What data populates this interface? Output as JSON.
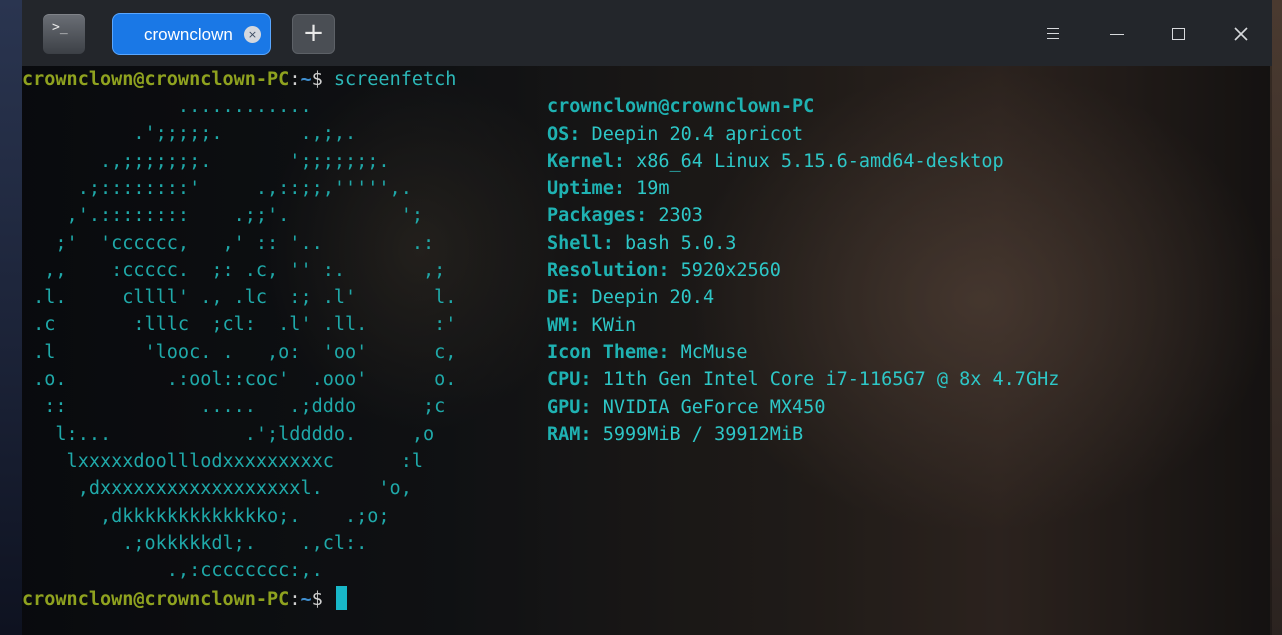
{
  "tabs": [
    {
      "label": "crownclown",
      "close": "×"
    }
  ],
  "toolbar": {
    "new_tab": "+",
    "app_icon_glyph": ">_"
  },
  "window_controls": {
    "menu": "≡",
    "minimize": "—",
    "maximize": "☐",
    "close": "✕"
  },
  "prompt": {
    "user_host": "crownclown@crownclown-PC",
    "sep": ":",
    "path": "~",
    "symbol": "$ ",
    "command": "screenfetch"
  },
  "logo_lines": [
    "              ............",
    "          .';;;;;.       .,;,.",
    "       .,;;;;;;;.       ';;;;;;;.",
    "     .;::::::::'     .,::;;,''''',.",
    "    ,'.::::::::    .;;'.          ';",
    "   ;'  'cccccc,   ,' :: '..        .:",
    "  ,,    :ccccc.  ;: .c, '' :.       ,;",
    " .l.     cllll' ., .lc  :; .l'       l.",
    " .c       :lllc  ;cl:  .l' .ll.      :'",
    " .l        'looc. .   ,o:  'oo'      c,",
    " .o.         .:ool::coc'  .ooo'      o.",
    "  ::            .....   .;dddo      ;c",
    "   l:...            .';lddddo.     ,o",
    "    lxxxxxdoolllodxxxxxxxxxc      :l",
    "     ,dxxxxxxxxxxxxxxxxxxl.     'o,",
    "       ,dkkkkkkkkkkkkko;.    .;o;",
    "         .;okkkkkdl;.    .,cl:.",
    "             .,:cccccccc:,."
  ],
  "info": {
    "header": "crownclown@crownclown-PC",
    "rows": [
      {
        "key": "OS:",
        "value": " Deepin 20.4 apricot"
      },
      {
        "key": "Kernel:",
        "value": " x86_64 Linux 5.15.6-amd64-desktop"
      },
      {
        "key": "Uptime:",
        "value": " 19m"
      },
      {
        "key": "Packages:",
        "value": " 2303"
      },
      {
        "key": "Shell:",
        "value": " bash 5.0.3"
      },
      {
        "key": "Resolution:",
        "value": " 5920x2560"
      },
      {
        "key": "DE:",
        "value": " Deepin 20.4"
      },
      {
        "key": "WM:",
        "value": " KWin"
      },
      {
        "key": "Icon Theme:",
        "value": " McMuse"
      },
      {
        "key": "CPU:",
        "value": " 11th Gen Intel Core i7-1165G7 @ 8x 4.7GHz"
      },
      {
        "key": "GPU:",
        "value": " NVIDIA GeForce MX450"
      },
      {
        "key": "RAM:",
        "value": " 5999MiB / 39912MiB"
      }
    ]
  },
  "colors": {
    "tab_active": "#1a78e6",
    "prompt_user": "#8fa21f",
    "prompt_path": "#3f8fd0",
    "accent_cyan": "#1fb2b2",
    "cursor": "#18b7c8"
  }
}
